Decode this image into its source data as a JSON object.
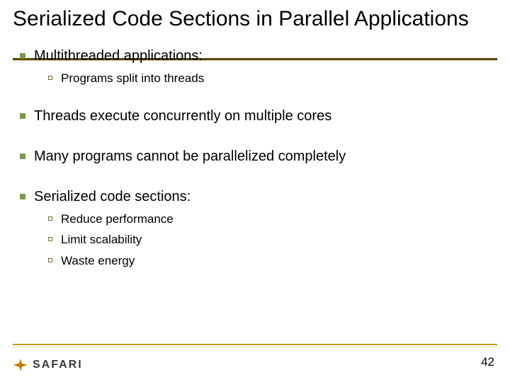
{
  "title": "Serialized Code Sections in Parallel Applications",
  "bullets": {
    "b1": "Multithreaded applications:",
    "b1_1": "Programs split into threads",
    "b2": "Threads execute concurrently on multiple cores",
    "b3": "Many programs cannot be parallelized completely",
    "b4": "Serialized code sections:",
    "b4_1": "Reduce performance",
    "b4_2": "Limit scalability",
    "b4_3": "Waste energy"
  },
  "footer": {
    "logo_text": "SAFARI",
    "page_number": "42"
  }
}
